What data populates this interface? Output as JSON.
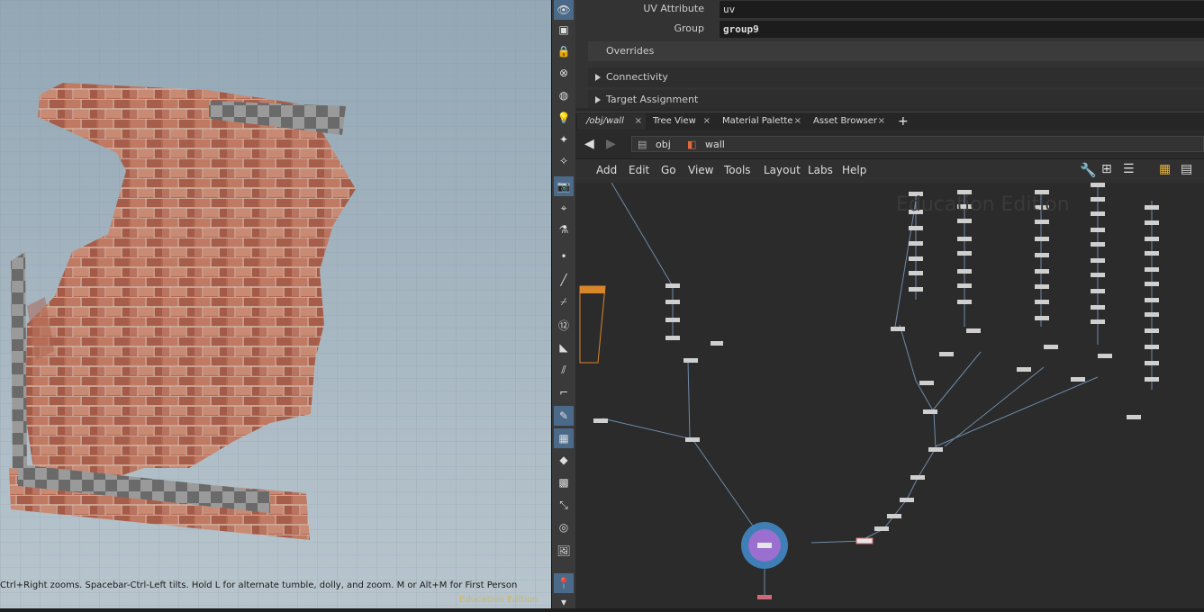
{
  "viewport": {
    "status_text": "Ctrl+Right zooms. Spacebar-Ctrl-Left tilts. Hold L for alternate tumble, dolly, and zoom. M or Alt+M for First Person",
    "edition_text": "Education Edition"
  },
  "params": {
    "uv_attribute_label": "UV Attribute",
    "uv_attribute_value": "uv",
    "group_label": "Group",
    "group_value": "group9",
    "overrides_label": "Overrides",
    "connectivity_label": "Connectivity",
    "target_assignment_label": "Target Assignment"
  },
  "tabs": [
    {
      "label": "/obj/wall"
    },
    {
      "label": "Tree View"
    },
    {
      "label": "Material Palette"
    },
    {
      "label": "Asset Browser"
    }
  ],
  "tab_close_symbol": "×",
  "add_tab_symbol": "+",
  "path": {
    "root": "obj",
    "node": "wall"
  },
  "menu": [
    "Add",
    "Edit",
    "Go",
    "View",
    "Tools",
    "Layout",
    "Labs",
    "Help"
  ],
  "network": {
    "watermark": "Education Edition"
  },
  "icons": {
    "toolbar": [
      "eye-icon",
      "snapshot-icon",
      "lock-icon",
      "no-entry-icon",
      "globe-icon",
      "bulb-icon",
      "lamp-icon",
      "lamp-off-icon",
      "camera-icon",
      "flashlight-icon",
      "spray-icon",
      "dot-icon",
      "brush-icon",
      "dropper-icon",
      "twelve-icon",
      "paint-icon",
      "measure-icon",
      "corner-icon",
      "pen-icon",
      "checker-icon",
      "diamond-icon",
      "crate-icon",
      "scale-icon",
      "circle-icon",
      "image-icon",
      "pin-icon"
    ]
  }
}
